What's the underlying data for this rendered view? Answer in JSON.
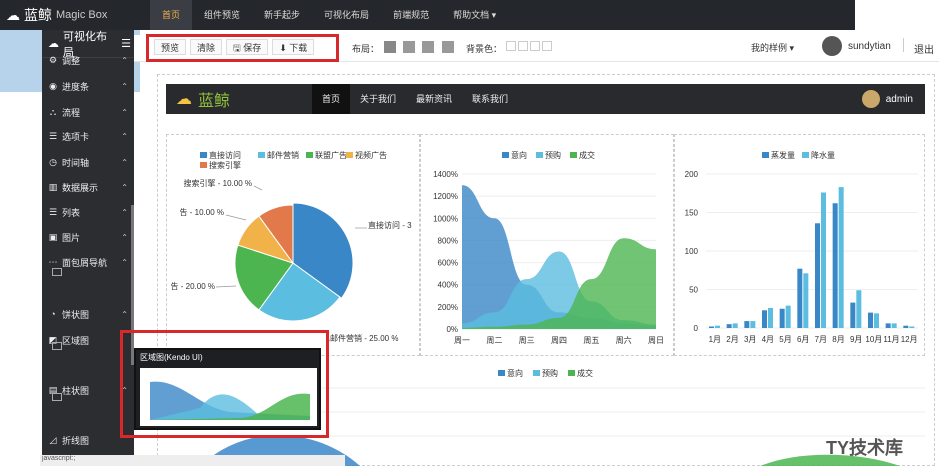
{
  "app": {
    "brand": "蓝鲸",
    "sub": "Magic Box"
  },
  "topnav": [
    {
      "label": "首页"
    },
    {
      "label": "组件预览"
    },
    {
      "label": "新手起步"
    },
    {
      "label": "可视化布局"
    },
    {
      "label": "前端规范"
    },
    {
      "label": "帮助文档 ▾"
    }
  ],
  "sidebar": {
    "title": "可视化布局",
    "items": [
      {
        "label": "调整",
        "icon": "sliders-icon"
      },
      {
        "label": "进度条",
        "icon": "progress-icon"
      },
      {
        "label": "流程",
        "icon": "flow-icon"
      },
      {
        "label": "选项卡",
        "icon": "tabs-icon"
      },
      {
        "label": "时间轴",
        "icon": "clock-icon"
      },
      {
        "label": "数据展示",
        "icon": "bar-chart-icon"
      },
      {
        "label": "列表",
        "icon": "list-icon"
      },
      {
        "label": "图片",
        "icon": "image-icon"
      },
      {
        "label": "面包屑导航",
        "icon": "breadcrumb-icon"
      },
      {
        "label": "饼状图",
        "icon": "pie-icon"
      },
      {
        "label": "区域图",
        "icon": "area-icon"
      },
      {
        "label": "柱状图",
        "icon": "column-icon"
      },
      {
        "label": "折线图",
        "icon": "line-icon"
      }
    ]
  },
  "toolbar": {
    "preview": "预览",
    "clear": "清除",
    "save": "保存",
    "download": "下载",
    "layout_label": "布局：",
    "bg_label": "背景色：",
    "mine": "我的样例 ▾",
    "user": "sundytian",
    "logout": "退出"
  },
  "preview": {
    "brand": "蓝鲸",
    "nav": [
      "首页",
      "关于我们",
      "最新资讯",
      "联系我们"
    ],
    "user": "admin"
  },
  "popup_title": "区域图(Kendo UI)",
  "watermark": "TY技术库",
  "status": "javascript:;",
  "colors": {
    "blue": "#3a87c8",
    "cyan": "#5bbde0",
    "green": "#4cb550",
    "yellow": "#f1b24a",
    "orange": "#e2794a"
  },
  "chart_data": [
    {
      "type": "pie",
      "legend": [
        "直接访问",
        "邮件营销",
        "联盟广告",
        "视频广告",
        "搜索引擎"
      ],
      "values": [
        35,
        25,
        20,
        10,
        10
      ],
      "labels": [
        "直接访问 - 3",
        "邮件营销 - 25.00 %",
        "告 - 20.00 %",
        "告 - 10.00 %",
        "搜索引擎 - 10.00 %"
      ]
    },
    {
      "type": "area",
      "legend": [
        "意向",
        "预购",
        "成交"
      ],
      "categories": [
        "周一",
        "周二",
        "周三",
        "周四",
        "周五",
        "周六",
        "周日"
      ],
      "yticks": [
        "0%",
        "200%",
        "400%",
        "600%",
        "800%",
        "1000%",
        "1200%",
        "1400%"
      ],
      "series": [
        {
          "name": "意向",
          "values": [
            1300,
            1000,
            400,
            150,
            100,
            50,
            30
          ]
        },
        {
          "name": "预购",
          "values": [
            50,
            150,
            450,
            700,
            250,
            80,
            40
          ]
        },
        {
          "name": "成交",
          "values": [
            10,
            20,
            40,
            100,
            450,
            820,
            720
          ]
        }
      ]
    },
    {
      "type": "bar",
      "legend": [
        "蒸发量",
        "降水量"
      ],
      "categories": [
        "1月",
        "2月",
        "3月",
        "4月",
        "5月",
        "6月",
        "7月",
        "8月",
        "9月",
        "10月",
        "11月",
        "12月"
      ],
      "yticks": [
        "0",
        "50",
        "100",
        "150",
        "200"
      ],
      "series": [
        {
          "name": "蒸发量",
          "values": [
            2,
            5,
            9,
            23,
            25,
            77,
            136,
            162,
            33,
            20,
            6,
            3
          ]
        },
        {
          "name": "降水量",
          "values": [
            3,
            6,
            9,
            26,
            29,
            71,
            176,
            183,
            49,
            19,
            6,
            2
          ]
        }
      ]
    },
    {
      "type": "area",
      "legend": [
        "意向",
        "预购",
        "成交"
      ]
    }
  ]
}
